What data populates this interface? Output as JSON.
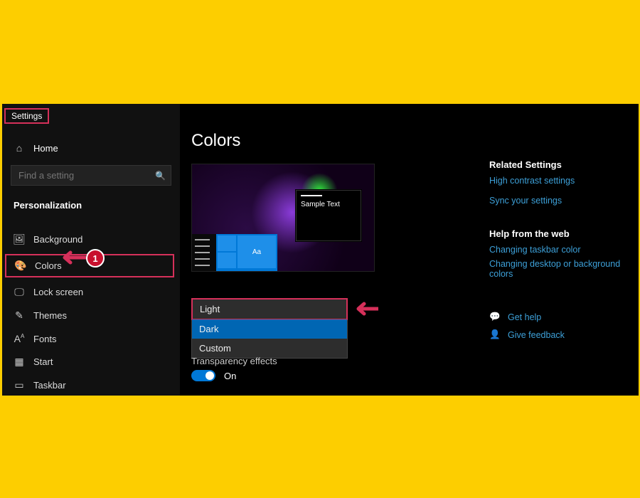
{
  "window": {
    "title": "Settings"
  },
  "sidebar": {
    "home": "Home",
    "search_placeholder": "Find a setting",
    "category": "Personalization",
    "items": [
      {
        "icon": "picture",
        "label": "Background"
      },
      {
        "icon": "palette",
        "label": "Colors",
        "active": true
      },
      {
        "icon": "monitor",
        "label": "Lock screen"
      },
      {
        "icon": "brush",
        "label": "Themes"
      },
      {
        "icon": "font",
        "label": "Fonts"
      },
      {
        "icon": "grid",
        "label": "Start"
      },
      {
        "icon": "taskbar",
        "label": "Taskbar"
      }
    ],
    "callout_number": "1"
  },
  "content": {
    "title": "Colors",
    "preview": {
      "sample_text": "Sample Text",
      "tile_text": "Aa"
    },
    "color_mode_options": [
      "Light",
      "Dark",
      "Custom"
    ],
    "color_mode_selected": "Dark",
    "color_mode_highlighted": "Light",
    "transparency_label": "Transparency effects",
    "transparency_state": "On"
  },
  "right": {
    "related_heading": "Related Settings",
    "related_links": [
      "High contrast settings",
      "Sync your settings"
    ],
    "help_heading": "Help from the web",
    "help_links": [
      "Changing taskbar color",
      "Changing desktop or background colors"
    ],
    "get_help": "Get help",
    "give_feedback": "Give feedback"
  },
  "colors": {
    "highlight": "#d6305a",
    "accent": "#0078d7",
    "link": "#3da0d8"
  }
}
